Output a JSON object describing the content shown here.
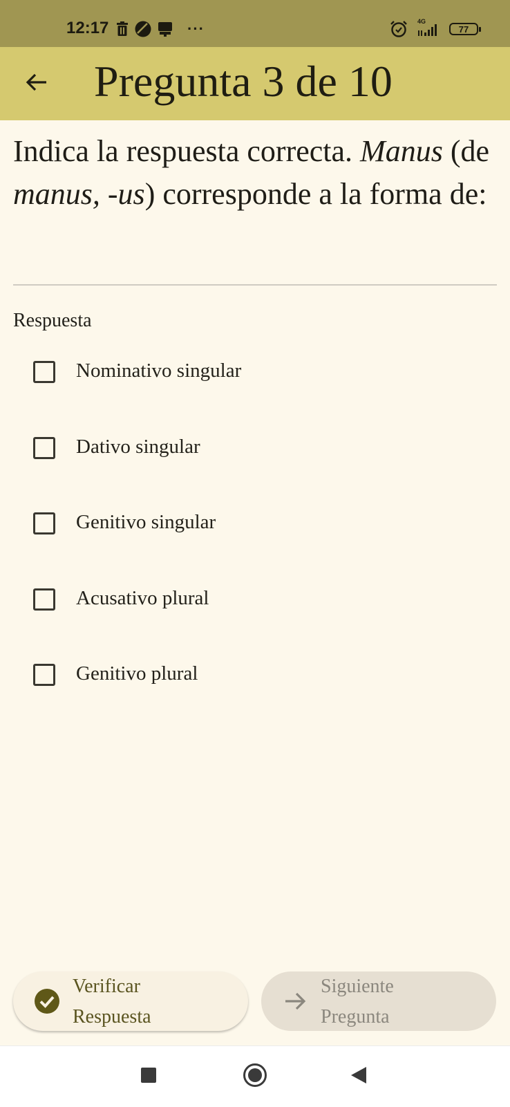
{
  "status_bar": {
    "time": "12:17",
    "left_icons": [
      "trash-icon",
      "circle-status-icon",
      "shop-icon"
    ],
    "more": "···",
    "right_icons": [
      "alarm-icon",
      "signal-icon"
    ],
    "network": "4G",
    "battery": "77"
  },
  "app_bar": {
    "back_icon": "arrow-left-icon",
    "title": "Pregunta 3 de 10",
    "background": "#d5c96f"
  },
  "question": {
    "prefix": "Indica la respuesta correcta. ",
    "word": "Manus",
    "mid_open": " (de ",
    "lemma": "manus, -us",
    "suffix": ") corresponde a la forma de:"
  },
  "answer_label": "Respuesta",
  "options": [
    {
      "label": "Nominativo singular",
      "checked": false
    },
    {
      "label": "Dativo singular",
      "checked": false
    },
    {
      "label": "Genitivo singular",
      "checked": false
    },
    {
      "label": "Acusativo plural",
      "checked": false
    },
    {
      "label": "Genitivo plural",
      "checked": false
    }
  ],
  "buttons": {
    "verify": {
      "line1": "Verificar",
      "line2": "Respuesta",
      "icon": "check-circle-icon"
    },
    "next": {
      "line1": "Siguiente",
      "line2": "Pregunta",
      "icon": "arrow-right-icon",
      "enabled": false
    }
  },
  "nav_bar": {
    "icons": [
      "recents-square-icon",
      "home-circle-icon",
      "back-triangle-icon"
    ]
  }
}
